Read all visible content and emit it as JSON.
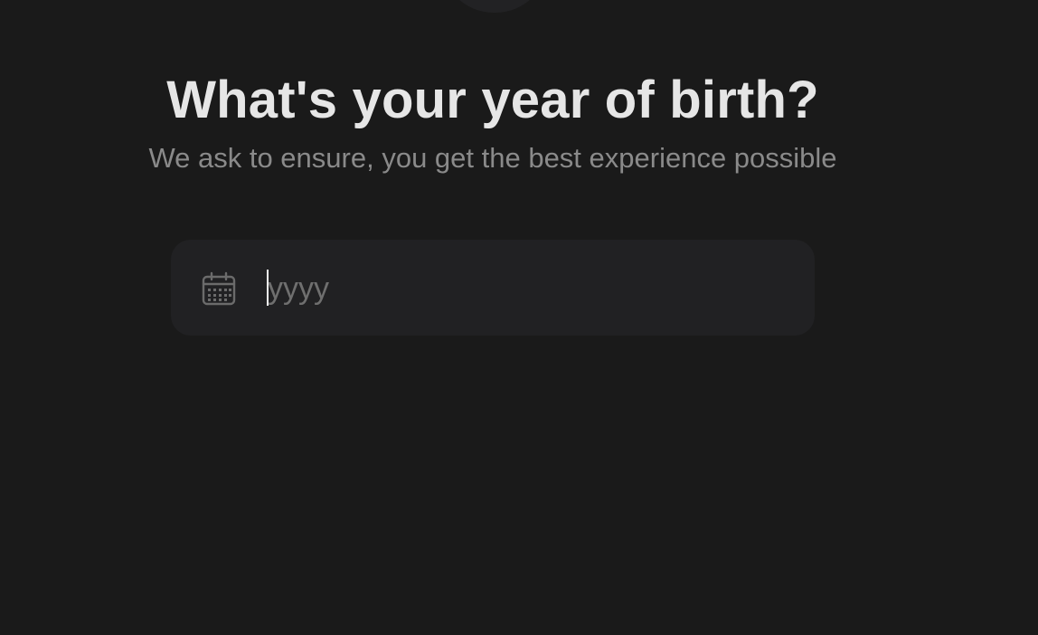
{
  "header": {
    "title": "What's your year of birth?",
    "subtitle": "We ask to ensure, you get the best experience possible"
  },
  "year_field": {
    "icon": "calendar-icon",
    "placeholder": "yyyy",
    "value": ""
  },
  "colors": {
    "background": "#1a1a1a",
    "field_background": "#212123",
    "title": "#e6e6e6",
    "subtitle": "#8a8a8a",
    "placeholder": "#6f6f6f"
  }
}
